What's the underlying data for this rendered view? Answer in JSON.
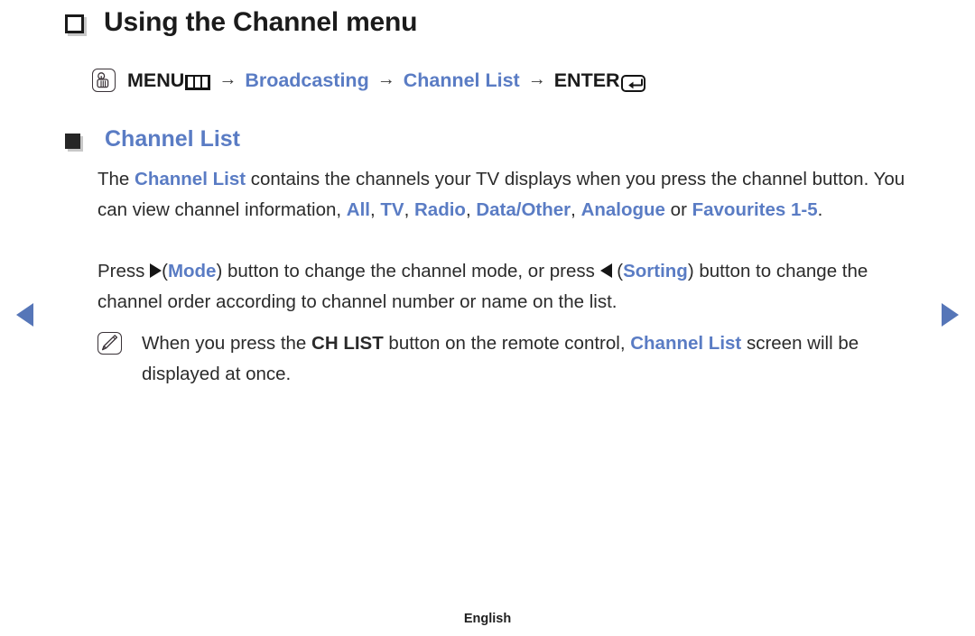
{
  "page": {
    "title": "Using the Channel menu",
    "title_bullet_icon": "square-outline-icon",
    "footer_language": "English"
  },
  "menu_path": {
    "hand_icon": "hand-press-icon",
    "menu_label": "MENU",
    "menu_bars_icon": "menu-bars-icon",
    "arrow_1": "→",
    "broadcasting_label": "Broadcasting",
    "arrow_2": "→",
    "channel_list_label": "Channel List",
    "arrow_3": "→",
    "enter_label": "ENTER",
    "enter_icon": "enter-key-icon"
  },
  "section": {
    "bullet_icon": "square-filled-icon",
    "heading": "Channel List"
  },
  "paragraph_1": {
    "t1": "The ",
    "k1": "Channel List",
    "t2": " contains the channels your TV displays when you press the channel button. You can view channel information, ",
    "k2": "All",
    "t3": ", ",
    "k3": "TV",
    "t4": ", ",
    "k4": "Radio",
    "t5": ", ",
    "k5": "Data/Other",
    "t6": ", ",
    "k6": "Analogue",
    "t7": " or ",
    "k7": "Favourites 1-5",
    "t8": "."
  },
  "paragraph_2": {
    "t1": "Press ",
    "icon_right": "triangle-right-icon",
    "t2": "(",
    "k1": "Mode",
    "t3": ") button to change the channel mode, or press ",
    "icon_left": "triangle-left-icon",
    "t4": " (",
    "k2": "Sorting",
    "t5": ") button to change the channel order according to channel number or name on the list."
  },
  "note": {
    "icon": "note-pen-icon",
    "t1": "When you press the ",
    "k1": "CH LIST",
    "t2": " button on the remote control, ",
    "k2": "Channel List",
    "t3": " screen will be displayed at once."
  },
  "nav": {
    "prev_icon": "nav-prev-arrow-icon",
    "next_icon": "nav-next-arrow-icon"
  },
  "colors": {
    "accent_blue": "#5a7cc4",
    "nav_blue": "#5676b8",
    "text": "#2b2b2b"
  }
}
